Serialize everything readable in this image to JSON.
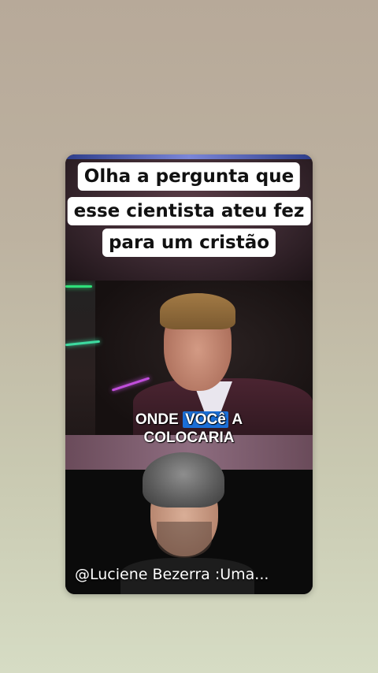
{
  "caption": {
    "line1": "Olha a pergunta que",
    "line2": "esse cientista ateu fez",
    "line3": "para um cristão"
  },
  "video_top": {
    "subtitle_pre": "ONDE ",
    "subtitle_highlight": "VOCê",
    "subtitle_post": " A",
    "subtitle_line2": "COLOCARIA"
  },
  "video_bottom": {
    "handle": "@Luciene Bezerra :Uma..."
  },
  "colors": {
    "highlight": "#1a6fd8",
    "caption_bg": "#ffffff",
    "page_bg_top": "#b7a999",
    "page_bg_bottom": "#d6dcc4"
  }
}
